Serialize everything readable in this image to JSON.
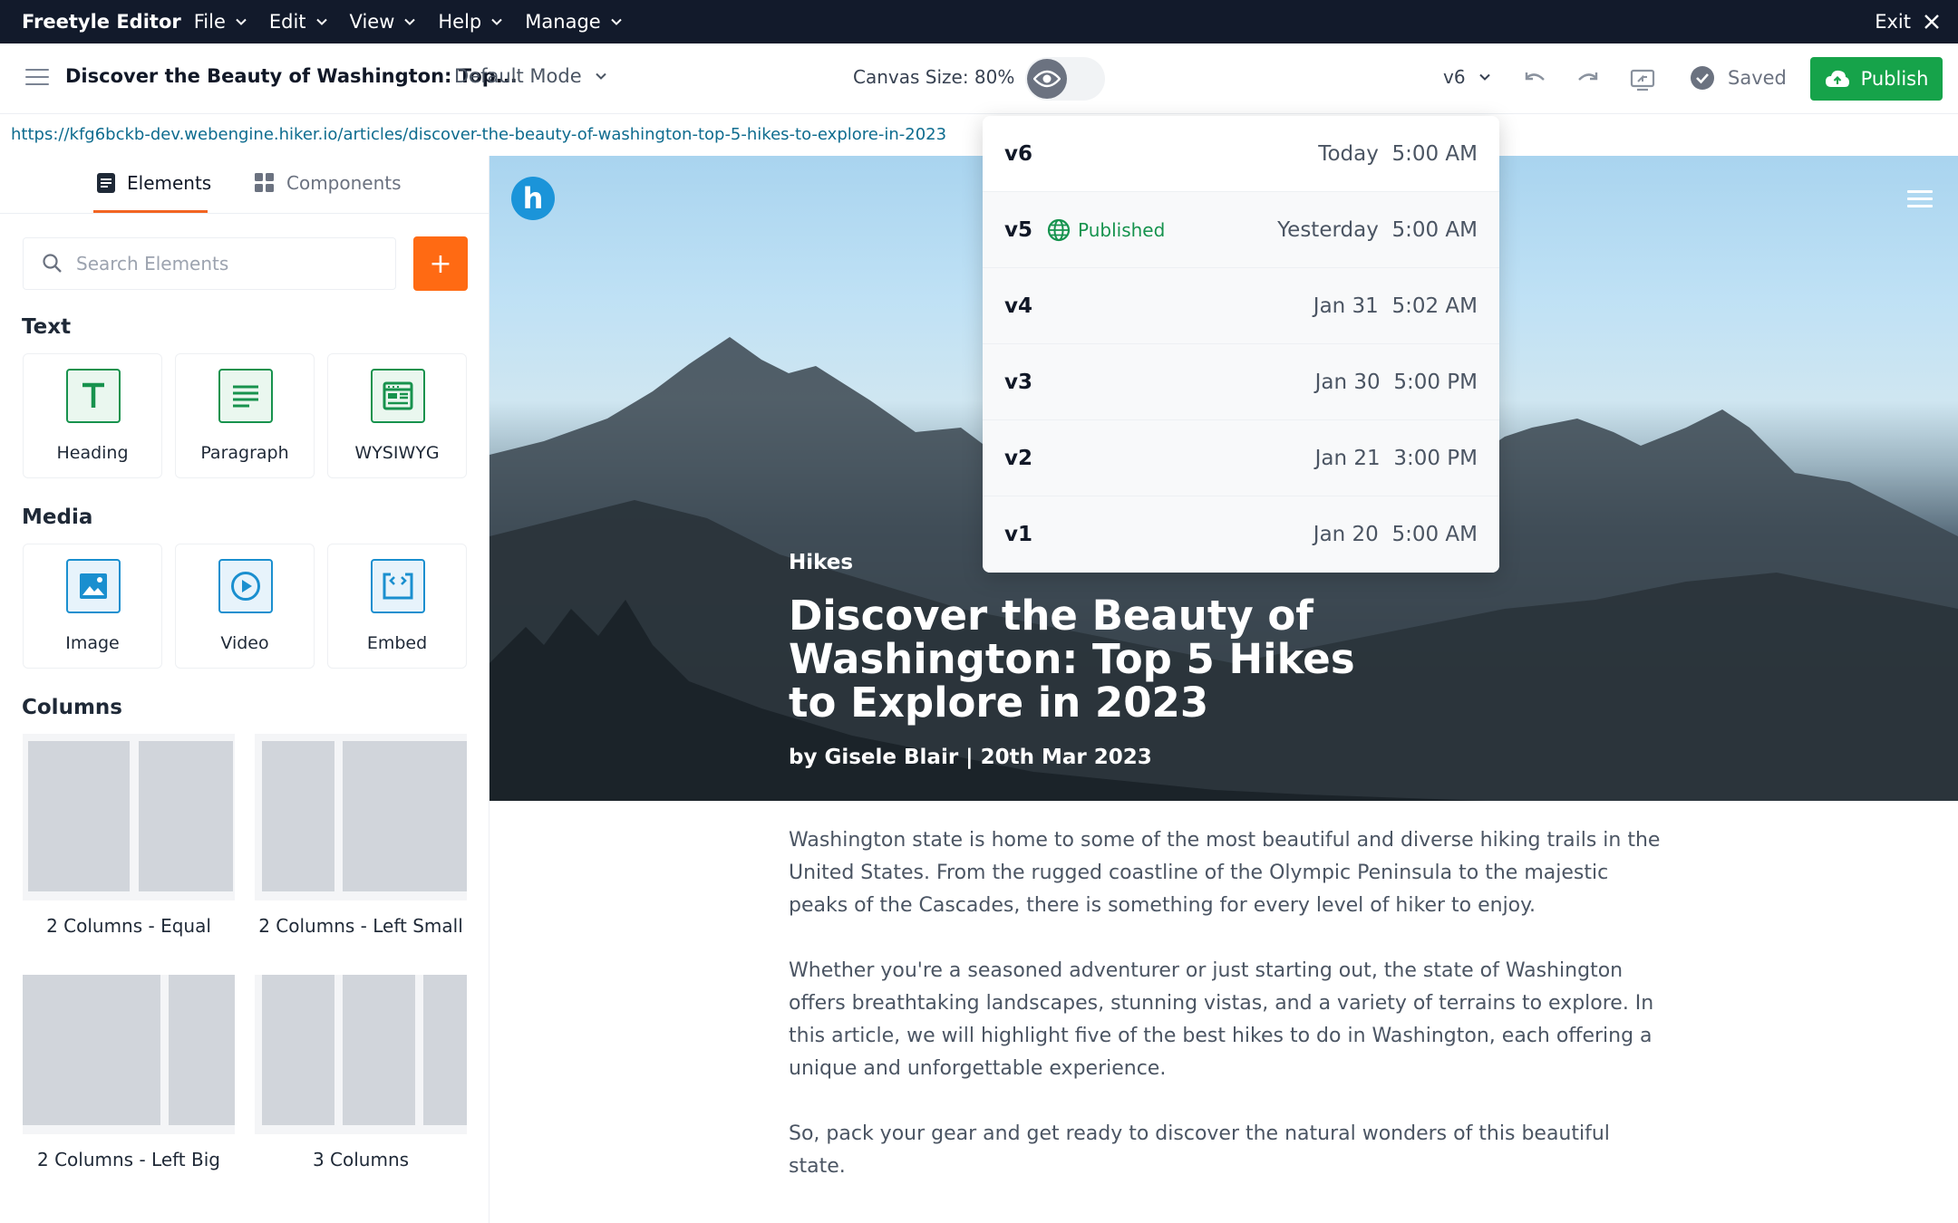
{
  "menubar": {
    "brand": "Freetyle Editor",
    "menus": [
      "File",
      "Edit",
      "View",
      "Help",
      "Manage"
    ],
    "exit_label": "Exit"
  },
  "toolbar": {
    "doc_title": "Discover the Beauty of Washington: Top...",
    "mode": "Default Mode",
    "canvas_size": "Canvas Size: 80%",
    "version": "v6",
    "saved_label": "Saved",
    "publish_label": "Publish"
  },
  "url": "https://kfg6bckb-dev.webengine.hiker.io/articles/discover-the-beauty-of-washington-top-5-hikes-to-explore-in-2023",
  "sidebar": {
    "tabs": [
      "Elements",
      "Components"
    ],
    "search_placeholder": "Search Elements",
    "add_label": "+",
    "sections": {
      "text": "Text",
      "media": "Media",
      "columns": "Columns"
    },
    "text_items": [
      "Heading",
      "Paragraph",
      "WYSIWYG"
    ],
    "media_items": [
      "Image",
      "Video",
      "Embed"
    ],
    "column_items": [
      "2 Columns - Equal",
      "2 Columns - Left Small",
      "2 Columns - Left Big",
      "3 Columns"
    ]
  },
  "versions": [
    {
      "name": "v6",
      "day": "Today",
      "time": "5:00 AM",
      "published": ""
    },
    {
      "name": "v5",
      "day": "Yesterday",
      "time": "5:00 AM",
      "published": "Published"
    },
    {
      "name": "v4",
      "day": "Jan 31",
      "time": "5:02 AM",
      "published": ""
    },
    {
      "name": "v3",
      "day": "Jan 30",
      "time": "5:00 PM",
      "published": ""
    },
    {
      "name": "v2",
      "day": "Jan 21",
      "time": "3:00 PM",
      "published": ""
    },
    {
      "name": "v1",
      "day": "Jan 20",
      "time": "5:00 AM",
      "published": ""
    }
  ],
  "article": {
    "logo_letter": "h",
    "category": "Hikes",
    "title": "Discover the Beauty of Washington: Top 5 Hikes to Explore in 2023",
    "byline": "by Gisele Blair | 20th Mar 2023",
    "paragraphs": [
      "Washington state is home to some of the most beautiful and diverse hiking trails in the United States. From the rugged coastline of the Olympic Peninsula to the majestic peaks of the Cascades, there is something for every level of hiker to enjoy.",
      "Whether you're a seasoned adventurer or just starting out, the state of Washington offers breathtaking landscapes, stunning vistas, and a variety of terrains to explore. In this article, we will highlight five of the best hikes to do in Washington, each offering a unique and unforgettable experience.",
      "So, pack your gear and get ready to discover the natural wonders of this beautiful state."
    ]
  },
  "colors": {
    "menubar_bg": "#121a2b",
    "accent_orange": "#ff6a13",
    "publish_green": "#16a34a",
    "link_blue": "#0e6c8f"
  }
}
